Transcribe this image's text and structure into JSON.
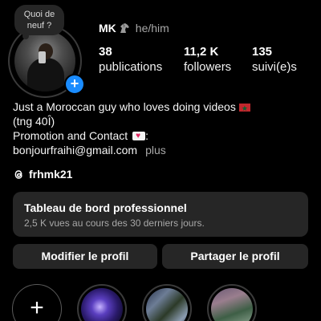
{
  "note": {
    "text": "Quoi de\nneuf ?"
  },
  "profile": {
    "name": "MK",
    "pronouns": "he/him"
  },
  "stats": [
    {
      "value": "38",
      "label": "publications"
    },
    {
      "value": "11,2 K",
      "label": "followers"
    },
    {
      "value": "135",
      "label": "suivi(e)s"
    }
  ],
  "bio": {
    "line1": "Just a Moroccan guy who loves doing videos",
    "line2": "(tng 40Ȋ)",
    "line3": "Promotion and Contact",
    "line3_suffix": ":",
    "email": "bonjourfraihi@gmail.com",
    "more": "plus"
  },
  "threads": {
    "handle": "frhmk21"
  },
  "dashboard": {
    "title": "Tableau de bord professionnel",
    "subtitle": "2,5 K vues au cours des 30 derniers jours."
  },
  "buttons": {
    "edit": "Modifier le profil",
    "share": "Partager le profil"
  },
  "highlights": {
    "new_symbol": "+"
  },
  "colors": {
    "background": "#000000",
    "card": "#262626",
    "accent": "#1a8cff",
    "secondary_text": "#a8a8a8"
  }
}
